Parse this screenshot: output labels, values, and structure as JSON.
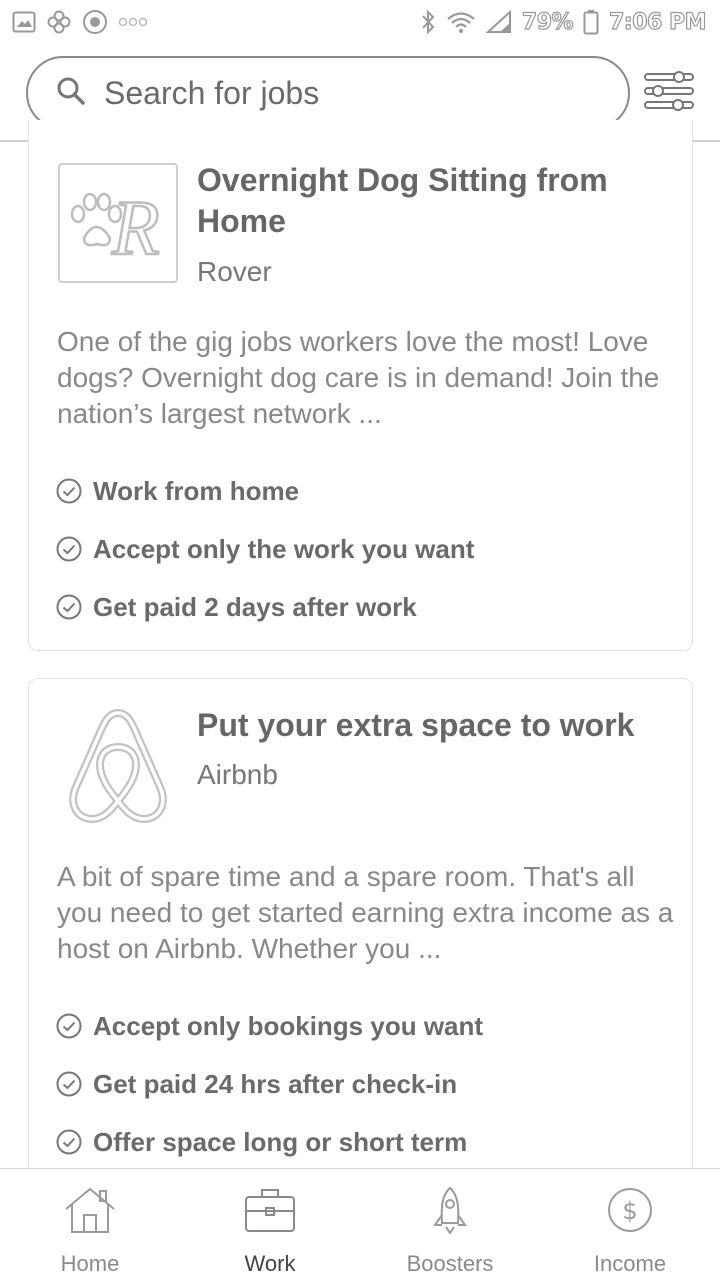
{
  "status_bar": {
    "battery": "79%",
    "time": "7:06 PM",
    "icons": [
      "image-icon",
      "pinwheel-icon",
      "target-icon",
      "more-dots-icon",
      "bluetooth-icon",
      "wifi-icon",
      "signal-icon",
      "battery-icon"
    ]
  },
  "search": {
    "placeholder": "Search for jobs",
    "value": ""
  },
  "jobs": [
    {
      "title": "Overnight Dog Sitting from Home",
      "company": "Rover",
      "logo": "rover-logo",
      "description": "One of the gig jobs workers love the most! Love dogs? Overnight dog care is in demand! Join the nation’s largest network ...",
      "features": [
        "Work from home",
        "Accept only the work you want",
        "Get paid 2 days after work"
      ]
    },
    {
      "title": "Put your extra space to work",
      "company": "Airbnb",
      "logo": "airbnb-logo",
      "description": "A bit of spare time and a spare room. That's all you need to get started earning extra income as a host on Airbnb. Whether you ...",
      "features": [
        "Accept only bookings you want",
        "Get paid 24 hrs after check-in",
        "Offer space long or short term"
      ]
    }
  ],
  "nav": {
    "items": [
      {
        "label": "Home",
        "icon": "house-icon"
      },
      {
        "label": "Work",
        "icon": "briefcase-icon"
      },
      {
        "label": "Boosters",
        "icon": "rocket-icon"
      },
      {
        "label": "Income",
        "icon": "dollar-circle-icon"
      }
    ],
    "active": "Work"
  },
  "colors": {
    "text_primary": "#666666",
    "text_secondary": "#888888",
    "border": "#e2e2e2"
  }
}
